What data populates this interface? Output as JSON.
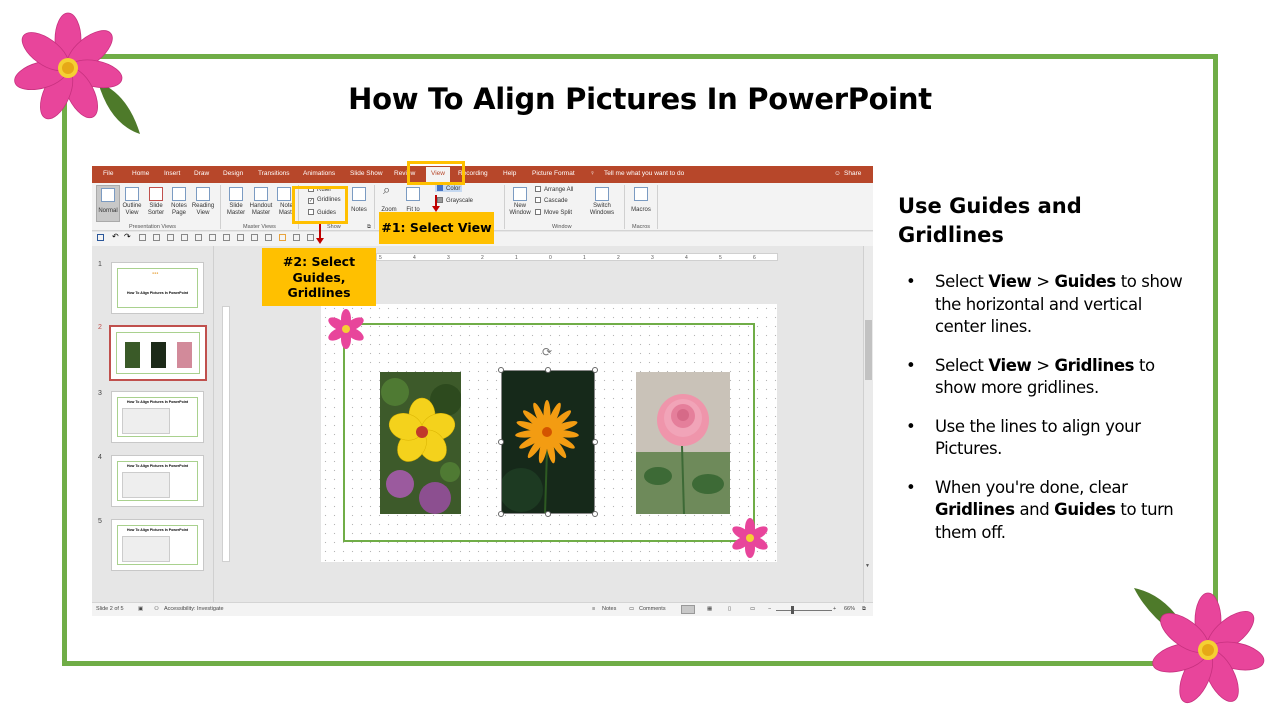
{
  "slide": {
    "title": "How To Align Pictures In PowerPoint",
    "frame_color": "#70ad47",
    "accent_color": "#ffc000"
  },
  "powerpoint": {
    "tabs": [
      "File",
      "Home",
      "Insert",
      "Draw",
      "Design",
      "Transitions",
      "Animations",
      "Slide Show",
      "Review",
      "View",
      "Recording",
      "Help",
      "Picture Format"
    ],
    "active_tab": "View",
    "tell_me": "Tell me what you want to do",
    "share": "Share",
    "ribbon": {
      "presentation_views": {
        "buttons": [
          "Normal",
          "Outline View",
          "Slide Sorter",
          "Notes Page",
          "Reading View"
        ],
        "group_label": "Presentation Views"
      },
      "master_views": {
        "buttons": [
          "Slide Master",
          "Handout Master",
          "Notes Master"
        ],
        "group_label": "Master Views"
      },
      "show": {
        "ruler": "Ruler",
        "gridlines": "Gridlines",
        "guides": "Guides",
        "notes": "Notes",
        "group_label": "Show"
      },
      "zoom": {
        "zoom": "Zoom",
        "fit_to": "Fit to"
      },
      "color": {
        "color": "Color",
        "grayscale": "Grayscale"
      },
      "window": {
        "new_window": "New Window",
        "arrange_all": "Arrange All",
        "cascade": "Cascade",
        "move_split": "Move Split",
        "switch_windows": "Switch Windows",
        "group_label": "Window"
      },
      "macros": {
        "macros": "Macros",
        "group_label": "Macros"
      }
    },
    "thumbnails": [
      {
        "num": "1",
        "title": "How To Align Pictures In PowerPoint"
      },
      {
        "num": "2",
        "title": ""
      },
      {
        "num": "3",
        "title": "How To Align Pictures In PowerPoint"
      },
      {
        "num": "4",
        "title": "How To Align Pictures In PowerPoint"
      },
      {
        "num": "5",
        "title": "How To Align Pictures In PowerPoint"
      }
    ],
    "selected_thumbnail": 2,
    "ruler_labels": [
      "5",
      "4",
      "3",
      "2",
      "1",
      "0",
      "1",
      "2",
      "3",
      "4",
      "5",
      "6"
    ],
    "status": {
      "slide_info": "Slide 2 of 5",
      "accessibility": "Accessibility: Investigate",
      "notes": "Notes",
      "comments": "Comments",
      "zoom": "66%"
    }
  },
  "callouts": {
    "step1": "#1: Select View",
    "step2": "#2: Select Guides, Gridlines"
  },
  "side": {
    "heading": "Use Guides and Gridlines",
    "bullets": [
      {
        "parts": [
          {
            "t": "Select "
          },
          {
            "t": "View",
            "b": true
          },
          {
            "t": " > "
          },
          {
            "t": "Guides",
            "b": true
          },
          {
            "t": " to show the horizontal and vertical center lines."
          }
        ]
      },
      {
        "parts": [
          {
            "t": "Select "
          },
          {
            "t": "View",
            "b": true
          },
          {
            "t": " > "
          },
          {
            "t": "Gridlines",
            "b": true
          },
          {
            "t": " to show more gridlines."
          }
        ]
      },
      {
        "parts": [
          {
            "t": "Use the lines to align your Pictures."
          }
        ]
      },
      {
        "parts": [
          {
            "t": "When you're done, clear "
          },
          {
            "t": "Gridlines",
            "b": true
          },
          {
            "t": " and "
          },
          {
            "t": "Guides",
            "b": true
          },
          {
            "t": " to turn them off."
          }
        ]
      }
    ]
  }
}
